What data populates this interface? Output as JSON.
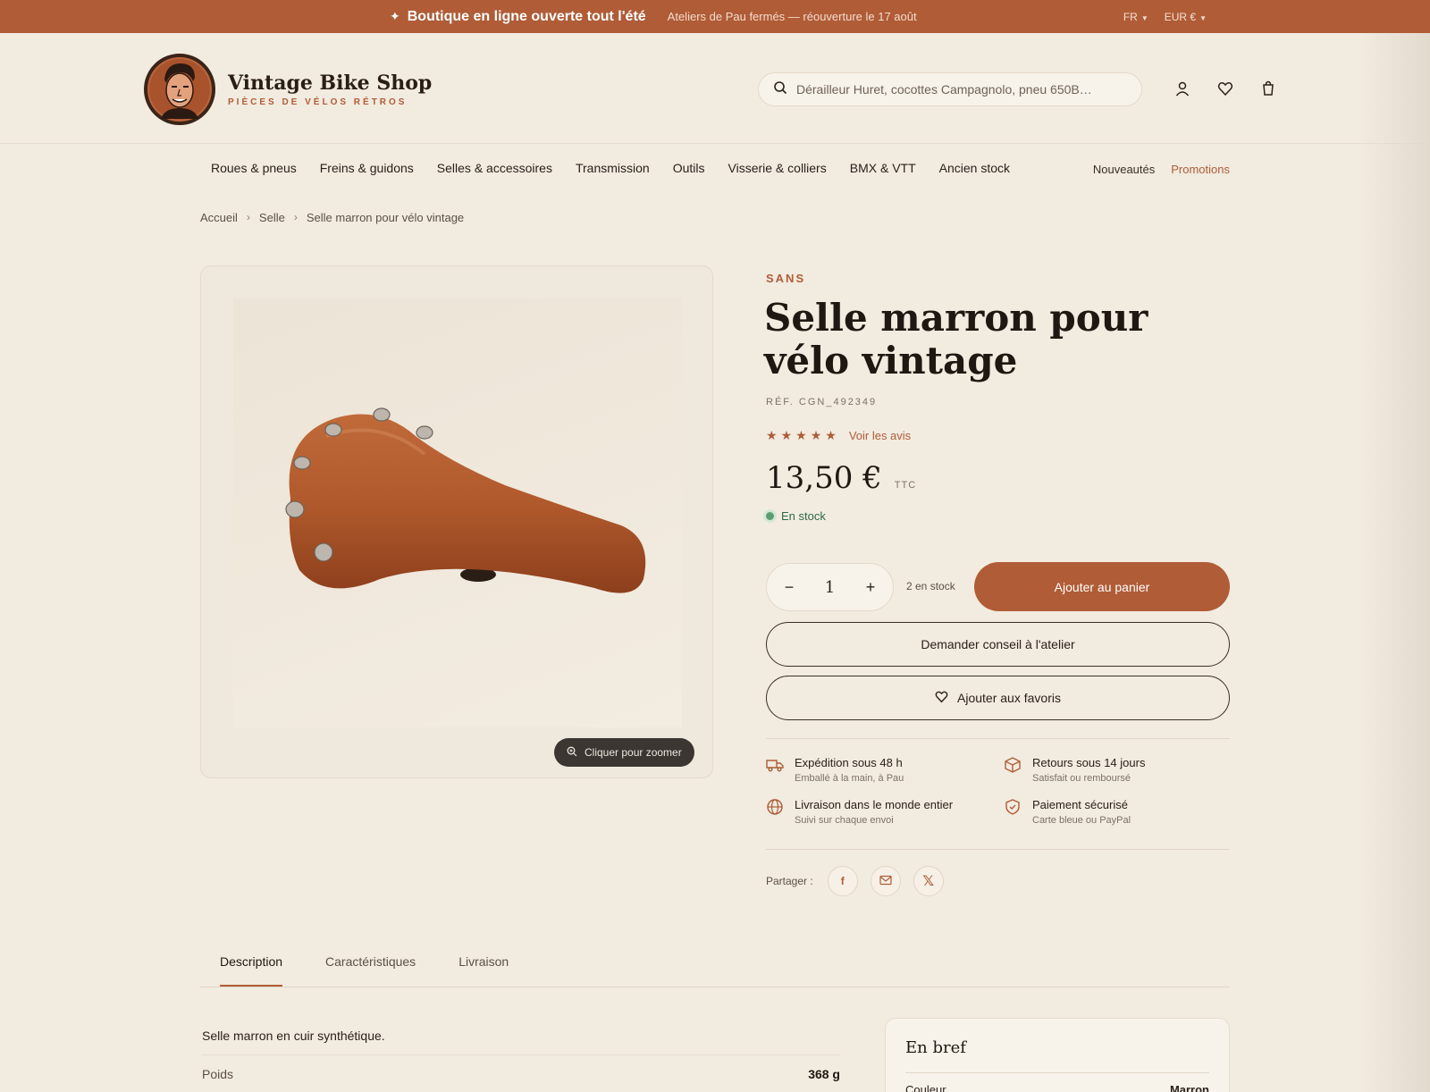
{
  "topbar": {
    "promo": "Boutique en ligne ouverte tout l'été",
    "closed_notice": "Ateliers de Pau fermés — réouverture le 17 août",
    "language": "FR",
    "currency": "EUR €"
  },
  "header": {
    "brand_name": "Vintage Bike Shop",
    "brand_tagline": "PIÈCES DE VÉLOS RÉTROS",
    "search_placeholder": "Dérailleur Huret, cocottes Campagnolo, pneu 650B…",
    "icons": [
      "account-icon",
      "heart-icon",
      "bag-icon"
    ]
  },
  "nav": {
    "items": [
      "Roues & pneus",
      "Freins & guidons",
      "Selles & accessoires",
      "Transmission",
      "Outils",
      "Visserie & colliers",
      "BMX & VTT",
      "Ancien stock"
    ],
    "new": "Nouveautés",
    "promotions": "Promotions"
  },
  "breadcrumb": [
    "Accueil",
    "Selle",
    "Selle marron pour vélo vintage"
  ],
  "product": {
    "brand": "SANS",
    "title": "Selle marron pour vélo vintage",
    "ref": "RÉF. CGN_492349",
    "stars": 5,
    "reviews_link": "Voir les avis",
    "price": "13,50 €",
    "tax": "TTC",
    "stock_status": "En stock",
    "quantity": "1",
    "available": "2 en stock",
    "add_to_cart": "Ajouter au panier",
    "advice": "Demander conseil à l'atelier",
    "favorite": "Ajouter aux favoris",
    "zoom_hint": "Cliquer pour zoomer"
  },
  "features": [
    {
      "icon": "truck-icon",
      "title": "Expédition sous 48 h",
      "sub": "Emballé à la main, à Pau"
    },
    {
      "icon": "box-icon",
      "title": "Retours sous 14 jours",
      "sub": "Satisfait ou remboursé"
    },
    {
      "icon": "globe-icon",
      "title": "Livraison dans le monde entier",
      "sub": "Suivi sur chaque envoi"
    },
    {
      "icon": "shield-icon",
      "title": "Paiement sécurisé",
      "sub": "Carte bleue ou PayPal"
    }
  ],
  "share": {
    "label": "Partager :"
  },
  "tabs": [
    "Description",
    "Caractéristiques",
    "Livraison"
  ],
  "description": {
    "text": "Selle marron en cuir synthétique.",
    "spec_key": "Poids",
    "spec_value": "368 g"
  },
  "summary": {
    "title": "En bref",
    "row_key": "Couleur",
    "row_value": "Marron"
  },
  "colors": {
    "accent": "#b05c36",
    "background": "#f2ebe0",
    "stock": "#5aa06e"
  }
}
